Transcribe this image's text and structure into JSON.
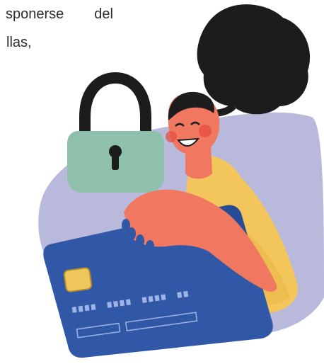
{
  "text_fragment": {
    "line1_words": [
      "sponerse",
      "del"
    ],
    "line2": "llas,"
  },
  "illustration": {
    "elements": [
      "padlock-icon",
      "woman-figure",
      "credit-card",
      "background-blob"
    ],
    "colors": {
      "blob": "#b9b9db",
      "padlock_body": "#8fc0ab",
      "padlock_shackle": "#1c1c1c",
      "hair": "#1c1c1c",
      "skin": "#f07860",
      "sweater": "#f2c65a",
      "card": "#3158a6",
      "card_dark": "#1e3f86",
      "chip": "#f0c75c"
    }
  }
}
